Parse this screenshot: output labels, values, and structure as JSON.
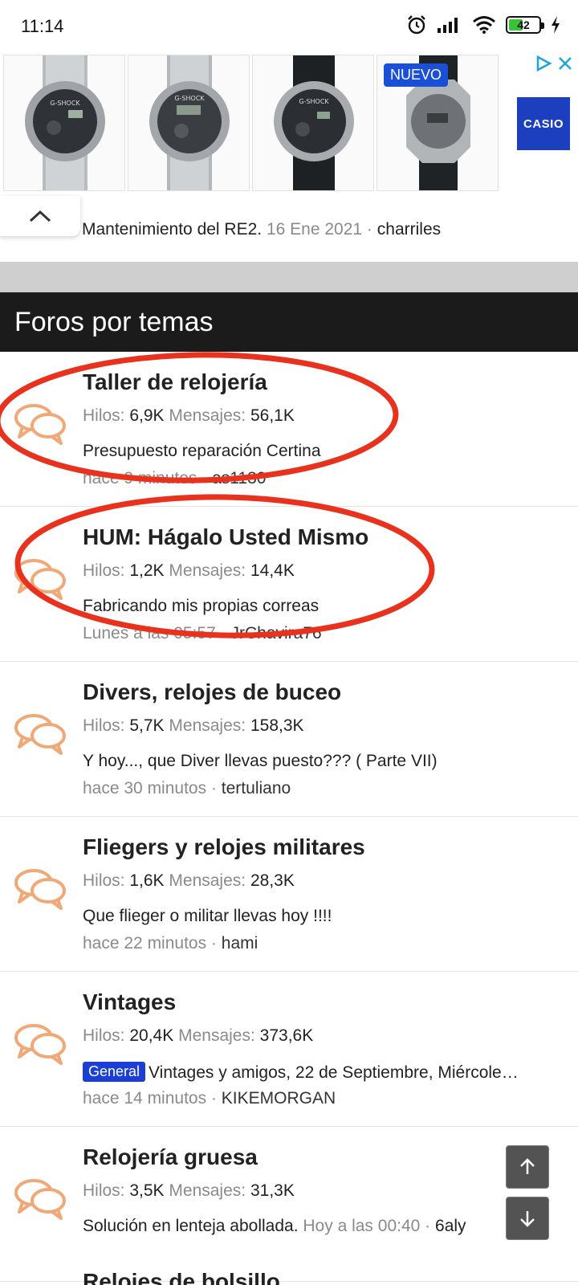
{
  "status_bar": {
    "time": "11:14",
    "battery_level": "42",
    "battery_color": "#37c437"
  },
  "ad": {
    "badge": "NUEVO",
    "brand": "CASIO",
    "tiles": [
      "G-SHOCK steel",
      "G-SHOCK steel digital",
      "G-SHOCK black strap",
      "G-SHOCK octagon"
    ],
    "brand_color": "#1c3fbf"
  },
  "last_post": {
    "title": "Mantenimiento del RE2.",
    "date": "16 Ene 2021",
    "separator": "·",
    "user": "charriles"
  },
  "section": {
    "title": "Foros por temas"
  },
  "labels": {
    "threads": "Hilos:",
    "messages": "Mensajes:"
  },
  "forums": [
    {
      "title": "Taller de relojería",
      "threads": "6,9K",
      "messages": "56,1K",
      "latest": "Presupuesto reparación Certina",
      "when": "hace 9 minutos",
      "user": "as1130",
      "highlighted": true
    },
    {
      "title": "HUM: Hágalo Usted Mismo",
      "threads": "1,2K",
      "messages": "14,4K",
      "latest": "Fabricando mis propias correas",
      "when": "Lunes a las 05:57",
      "user": "JrChavira76",
      "highlighted": true
    },
    {
      "title": "Divers, relojes de buceo",
      "threads": "5,7K",
      "messages": "158,3K",
      "latest": "Y hoy..., que Diver llevas puesto??? ( Parte VII)",
      "when": "hace 30 minutos",
      "user": "tertuliano",
      "highlighted": false
    },
    {
      "title": "Fliegers y relojes militares",
      "threads": "1,6K",
      "messages": "28,3K",
      "latest": "Que flieger o militar llevas hoy !!!!",
      "when": "hace 22 minutos",
      "user": "hami",
      "highlighted": false
    },
    {
      "title": "Vintages",
      "threads": "20,4K",
      "messages": "373,6K",
      "prefix": "General",
      "latest": "Vintages y amigos, 22 de Septiembre, Miércole…",
      "when": "hace 14 minutos",
      "user": "KIKEMORGAN",
      "highlighted": false
    },
    {
      "title": "Relojería gruesa",
      "threads": "3,5K",
      "messages": "31,3K",
      "latest": "Solución en lenteja abollada.",
      "latest_when": "Hoy a las 00:40",
      "user": "6aly",
      "highlighted": false
    }
  ],
  "partial_forum_title": "Relojes de bolsillo",
  "colors": {
    "annotation_red": "#e8321e",
    "icon_orange": "#f0a877",
    "header_bg": "#1b1b1b",
    "prefix_blue": "#1b3fd6"
  }
}
